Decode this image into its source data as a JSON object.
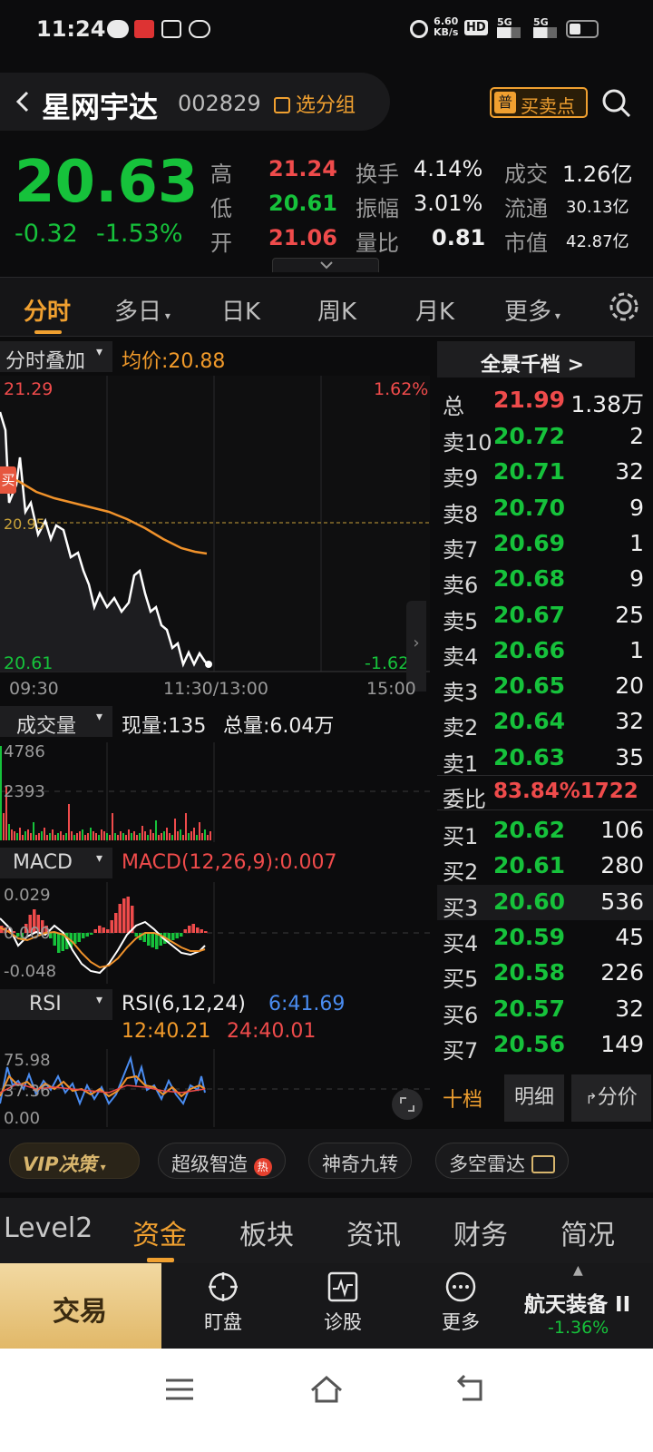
{
  "status_bar": {
    "time": "11:24",
    "net_speed_top": "6.60",
    "net_speed_unit": "KB/s",
    "hd": "HD",
    "sig1": "5G",
    "sig2": "5G"
  },
  "header": {
    "stock_name": "星网宇达",
    "stock_code": "002829",
    "group_label": "选分组",
    "badge_small": "普",
    "badge_label": "买卖点"
  },
  "quote": {
    "price": "20.63",
    "change": "-0.32",
    "change_pct": "-1.53%",
    "labels": {
      "high": "高",
      "low": "低",
      "open": "开",
      "turnover": "换手",
      "amplitude": "振幅",
      "vol_ratio": "量比",
      "amount": "成交",
      "float": "流通",
      "mcap": "市值"
    },
    "values": {
      "high": "21.24",
      "low": "20.61",
      "open": "21.06",
      "turnover": "4.14%",
      "amplitude": "3.01%",
      "vol_ratio": "0.81",
      "amount": "1.26亿",
      "float": "30.13亿",
      "mcap": "42.87亿"
    }
  },
  "tabs": [
    "分时",
    "多日",
    "日K",
    "周K",
    "月K",
    "更多"
  ],
  "chart": {
    "overlay_label": "分时叠加",
    "avg_label": "均价:20.88",
    "y_top": "21.29",
    "y_bottom": "20.61",
    "pct_top": "1.62%",
    "pct_bottom": "-1.62%",
    "prev_close": "20.95",
    "buy_marker": "买",
    "x_start": "09:30",
    "x_mid": "11:30/13:00",
    "x_end": "15:00",
    "vol_label": "成交量",
    "vol_now": "现量:135",
    "vol_total": "总量:6.04万",
    "vol_top": "4786",
    "vol_mid": "2393",
    "macd_label": "MACD",
    "macd_value": "MACD(12,26,9):0.007",
    "macd_top": "0.029",
    "macd_zero": "0.000",
    "macd_bottom": "-0.048",
    "rsi_label": "RSI",
    "rsi_title": "RSI(6,12,24)",
    "rsi6": "6:41.69",
    "rsi12": "12:40.21",
    "rsi24": "24:40.01",
    "rsi_top": "75.98",
    "rsi_mid": "37.36",
    "rsi_bottom": "0.00",
    "colors": {
      "price": "#ffffff",
      "avg": "#f0922b",
      "up": "#ef4b4b",
      "down": "#16c23b"
    }
  },
  "orderbook": {
    "title": "全景千档 >",
    "total": {
      "label": "总",
      "price": "21.99",
      "vol": "1.38万"
    },
    "asks": [
      {
        "label": "卖10",
        "price": "20.72",
        "vol": "2"
      },
      {
        "label": "卖9",
        "price": "20.71",
        "vol": "32"
      },
      {
        "label": "卖8",
        "price": "20.70",
        "vol": "9"
      },
      {
        "label": "卖7",
        "price": "20.69",
        "vol": "1"
      },
      {
        "label": "卖6",
        "price": "20.68",
        "vol": "9"
      },
      {
        "label": "卖5",
        "price": "20.67",
        "vol": "25"
      },
      {
        "label": "卖4",
        "price": "20.66",
        "vol": "1"
      },
      {
        "label": "卖3",
        "price": "20.65",
        "vol": "20"
      },
      {
        "label": "卖2",
        "price": "20.64",
        "vol": "32"
      },
      {
        "label": "卖1",
        "price": "20.63",
        "vol": "35"
      }
    ],
    "ratio": {
      "label": "委比",
      "value": "83.84%1722"
    },
    "bids": [
      {
        "label": "买1",
        "price": "20.62",
        "vol": "106"
      },
      {
        "label": "买2",
        "price": "20.61",
        "vol": "280"
      },
      {
        "label": "买3",
        "price": "20.60",
        "vol": "536"
      },
      {
        "label": "买4",
        "price": "20.59",
        "vol": "45"
      },
      {
        "label": "买5",
        "price": "20.58",
        "vol": "226"
      },
      {
        "label": "买6",
        "price": "20.57",
        "vol": "32"
      },
      {
        "label": "买7",
        "price": "20.56",
        "vol": "149"
      }
    ],
    "buttons": [
      "十档",
      "明细",
      "分价"
    ]
  },
  "pills": [
    "VIP决策",
    "超级智造",
    "神奇九转",
    "多空雷达"
  ],
  "hot_badge": "热",
  "subtabs": [
    "Level2",
    "资金",
    "板块",
    "资讯",
    "财务",
    "简况"
  ],
  "actions": {
    "trade": "交易",
    "watch": "盯盘",
    "diagnose": "诊股",
    "more": "更多",
    "sector_name": "航天装备 II",
    "sector_change": "-1.36%"
  }
}
